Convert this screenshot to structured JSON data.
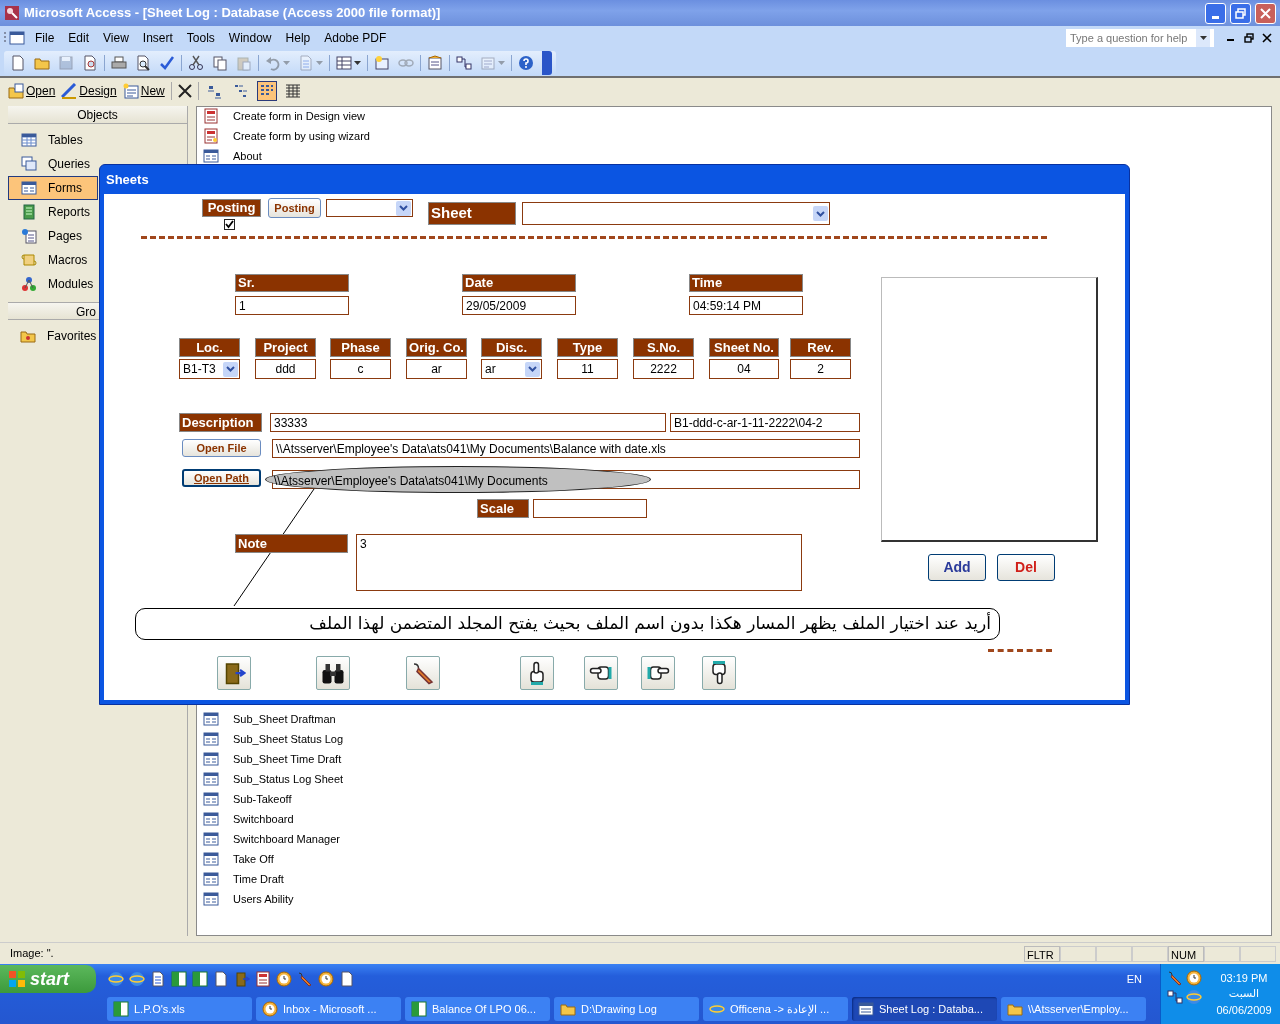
{
  "title": "Microsoft Access - [Sheet Log : Database (Access 2000 file format)]",
  "menu": [
    "File",
    "Edit",
    "View",
    "Insert",
    "Tools",
    "Window",
    "Help",
    "Adobe PDF"
  ],
  "help_box": {
    "placeholder": "Type a question for help"
  },
  "toolbar": [
    {
      "kind": "new",
      "disabled": false,
      "dropdown": false
    },
    {
      "kind": "open",
      "disabled": false,
      "dropdown": false
    },
    {
      "kind": "save",
      "disabled": true,
      "dropdown": false
    },
    {
      "kind": "search",
      "disabled": false,
      "dropdown": false
    },
    {
      "kind": "print",
      "disabled": false,
      "dropdown": false
    },
    {
      "kind": "preview",
      "disabled": false,
      "dropdown": false
    },
    {
      "kind": "spell",
      "disabled": false,
      "dropdown": false
    },
    {
      "kind": "cut",
      "disabled": false,
      "dropdown": false
    },
    {
      "kind": "copy",
      "disabled": false,
      "dropdown": false
    },
    {
      "kind": "paste",
      "disabled": true,
      "dropdown": false
    },
    {
      "kind": "undo",
      "disabled": true,
      "dropdown": true
    },
    {
      "kind": "word",
      "disabled": true,
      "dropdown": true
    },
    {
      "kind": "analyze",
      "disabled": false,
      "dropdown": true
    },
    {
      "kind": "code",
      "disabled": false,
      "dropdown": false
    },
    {
      "kind": "links",
      "disabled": true,
      "dropdown": false
    },
    {
      "kind": "properties",
      "disabled": false,
      "dropdown": false
    },
    {
      "kind": "relationships",
      "disabled": false,
      "dropdown": false
    },
    {
      "kind": "newobject",
      "disabled": true,
      "dropdown": true
    },
    {
      "kind": "help",
      "disabled": false,
      "dropdown": false
    }
  ],
  "db_toolbar": {
    "buttons": [
      {
        "kind": "open",
        "label": "Open"
      },
      {
        "kind": "design",
        "label": "Design"
      },
      {
        "kind": "new",
        "label": "New"
      }
    ],
    "views": [
      {
        "kind": "large",
        "selected": false
      },
      {
        "kind": "small",
        "selected": false
      },
      {
        "kind": "list",
        "selected": true
      },
      {
        "kind": "details",
        "selected": false
      }
    ]
  },
  "objects": {
    "header": "Objects",
    "items": [
      {
        "kind": "tables",
        "label": "Tables",
        "selected": false
      },
      {
        "kind": "queries",
        "label": "Queries",
        "selected": false
      },
      {
        "kind": "forms",
        "label": "Forms",
        "selected": true
      },
      {
        "kind": "reports",
        "label": "Reports",
        "selected": false
      },
      {
        "kind": "pages",
        "label": "Pages",
        "selected": false
      },
      {
        "kind": "macros",
        "label": "Macros",
        "selected": false
      },
      {
        "kind": "modules",
        "label": "Modules",
        "selected": false
      }
    ],
    "groups_header": "Gro",
    "groups": [
      {
        "kind": "favorites",
        "label": "Favorites"
      }
    ]
  },
  "list_top": [
    {
      "kind": "design",
      "label": "Create form in Design view"
    },
    {
      "kind": "wizard",
      "label": "Create form by using wizard"
    },
    {
      "kind": "form",
      "label": "About"
    }
  ],
  "list_bottom": [
    "Sub_Sheet Draftman",
    "Sub_Sheet Status Log",
    "Sub_Sheet Time Draft",
    "Sub_Status Log Sheet",
    "Sub-Takeoff",
    "Switchboard",
    "Switchboard Manager",
    "Take Off",
    "Time Draft",
    "Users Ability"
  ],
  "form": {
    "title": "Sheets",
    "posting": {
      "label": "Posting",
      "checked": true
    },
    "posting_button": "Posting",
    "sheet_label": "Sheet",
    "header_fields": [
      {
        "label": "Sr.",
        "value": "1"
      },
      {
        "label": "Date",
        "value": "29/05/2009"
      },
      {
        "label": "Time",
        "value": "04:59:14 PM"
      }
    ],
    "code_fields": [
      {
        "label": "Loc.",
        "value": "B1-T3",
        "kind": "combo"
      },
      {
        "label": "Project",
        "value": "ddd",
        "kind": "text"
      },
      {
        "label": "Phase",
        "value": "c",
        "kind": "text"
      },
      {
        "label": "Orig. Co.",
        "value": "ar",
        "kind": "text"
      },
      {
        "label": "Disc.",
        "value": "ar",
        "kind": "combo"
      },
      {
        "label": "Type",
        "value": "11",
        "kind": "text"
      },
      {
        "label": "S.No.",
        "value": "2222",
        "kind": "text"
      },
      {
        "label": "Sheet No.",
        "value": "04",
        "kind": "text"
      },
      {
        "label": "Rev.",
        "value": "2",
        "kind": "text"
      }
    ],
    "description": {
      "label": "Description",
      "value": "33333",
      "code": "B1-ddd-c-ar-1-11-2222\\04-2"
    },
    "open_file": {
      "label": "Open File",
      "path": "\\\\Atsserver\\Employee's Data\\ats041\\My Documents\\Balance with date.xls"
    },
    "open_path": {
      "label": "Open Path",
      "path": "\\\\Atsserver\\Employee's Data\\ats041\\My Documents"
    },
    "scale_label": "Scale",
    "note": {
      "label": "Note",
      "value": "3"
    },
    "buttons": [
      {
        "kind": "add",
        "label": "Add"
      },
      {
        "kind": "del",
        "label": "Del"
      }
    ],
    "callout": "أريد عند اختيار الملف يظهر المسار هكذا بدون اسم الملف بحيث يفتح المجلد المتضمن لهذا الملف",
    "nav": [
      {
        "kind": "exit"
      },
      {
        "kind": "find"
      },
      {
        "kind": "edit"
      },
      {
        "kind": "up"
      },
      {
        "kind": "left"
      },
      {
        "kind": "right"
      },
      {
        "kind": "down"
      }
    ]
  },
  "status_bar": {
    "text": "Image: \".",
    "indicators": [
      "FLTR",
      "NUM"
    ]
  },
  "taskbar": {
    "start": "start",
    "tasks": [
      {
        "kind": "excel",
        "label": "L.P.O's.xls",
        "selected": false
      },
      {
        "kind": "outlook",
        "label": "Inbox - Microsoft ...",
        "selected": false
      },
      {
        "kind": "excel",
        "label": "Balance Of LPO 06...",
        "selected": false
      },
      {
        "kind": "folder",
        "label": "D:\\Drawing Log",
        "selected": false
      },
      {
        "kind": "browser",
        "label": "Officena -> الإعادة ...",
        "selected": false
      },
      {
        "kind": "access",
        "label": "Sheet Log : Databa...",
        "selected": true
      },
      {
        "kind": "folder",
        "label": "\\\\Atsserver\\Employ...",
        "selected": false
      }
    ],
    "language": "EN",
    "clock": {
      "time": "03:19 PM",
      "day": "السبت",
      "date": "06/06/2009"
    }
  }
}
